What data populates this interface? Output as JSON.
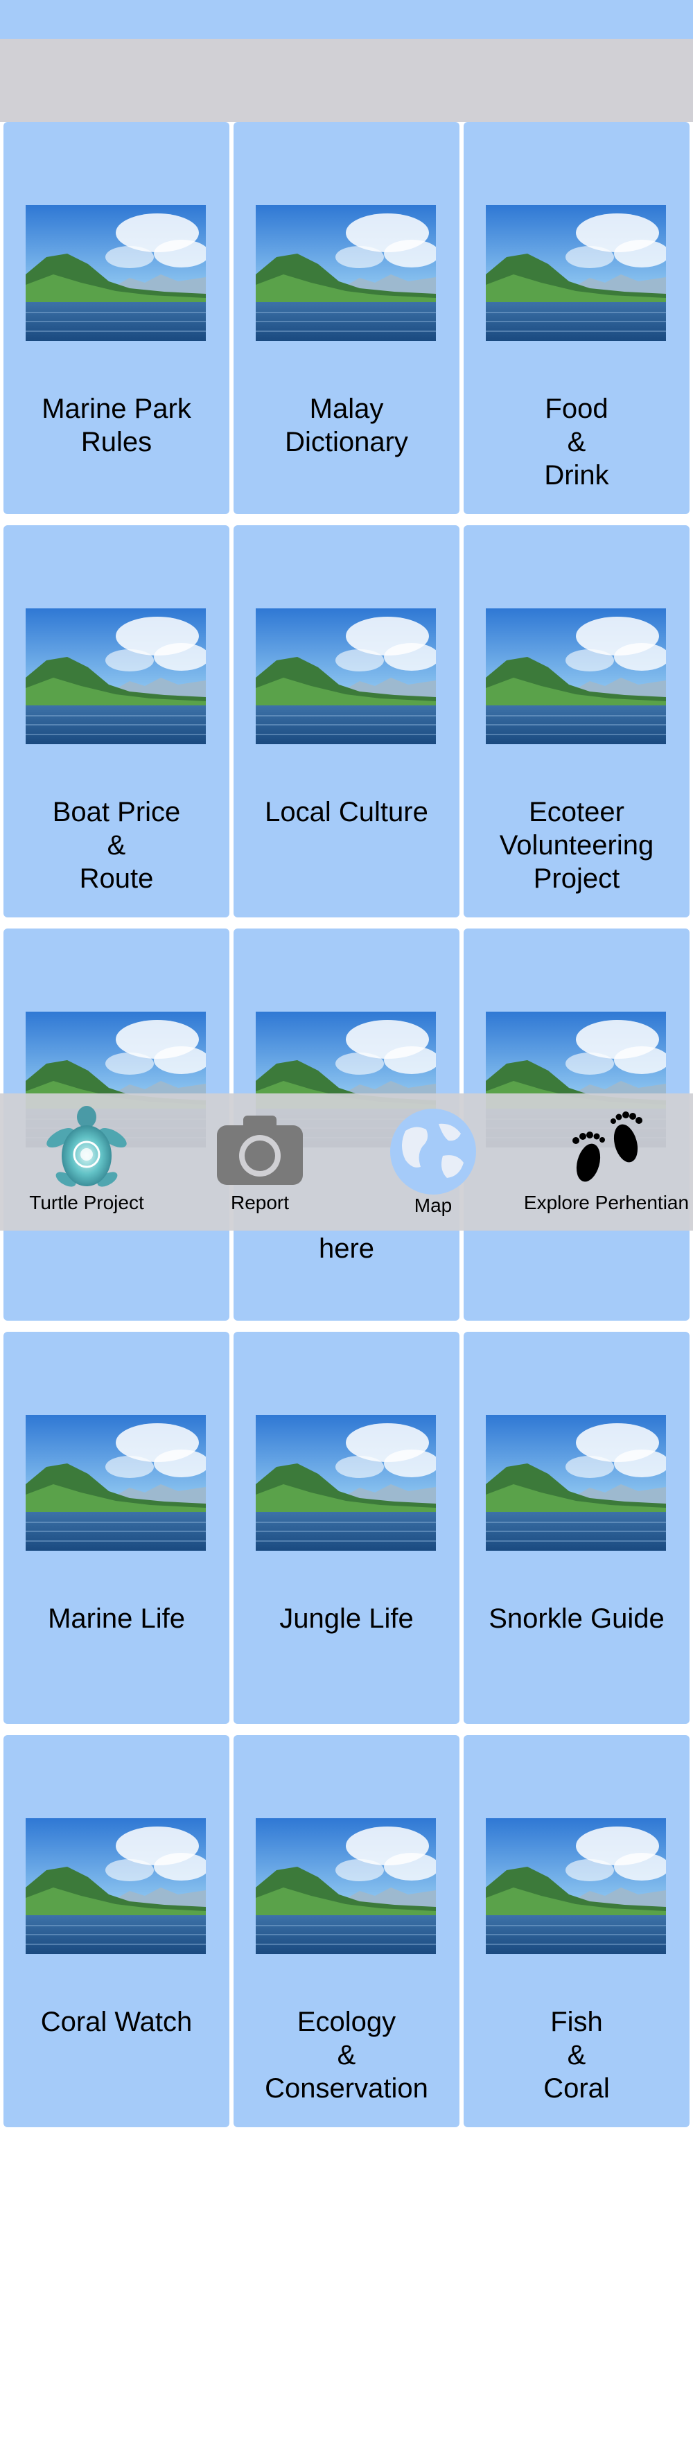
{
  "tiles": [
    {
      "label": "Marine Park\nRules"
    },
    {
      "label": "Malay\nDictionary"
    },
    {
      "label": "Food\n&\nDrink"
    },
    {
      "label": "Boat Price\n&\nRoute"
    },
    {
      "label": "Local Culture"
    },
    {
      "label": "Ecoteer\nVolunteering\nProject"
    },
    {
      "label": ""
    },
    {
      "label": "here"
    },
    {
      "label": ""
    },
    {
      "label": "Marine Life"
    },
    {
      "label": "Jungle Life"
    },
    {
      "label": "Snorkle Guide"
    },
    {
      "label": "Coral Watch"
    },
    {
      "label": "Ecology\n&\nConservation"
    },
    {
      "label": "Fish\n&\nCoral"
    }
  ],
  "tabbar": {
    "items": [
      {
        "label": "Turtle Project",
        "icon": "turtle-icon"
      },
      {
        "label": "Report",
        "icon": "camera-icon"
      },
      {
        "label": "Map",
        "icon": "globe-icon"
      },
      {
        "label": "Explore Perhentian",
        "icon": "footprints-icon"
      }
    ]
  },
  "colors": {
    "tile": "#a5cbf9",
    "header": "#d1d0d5",
    "tabbar": "#d0d0d4"
  }
}
